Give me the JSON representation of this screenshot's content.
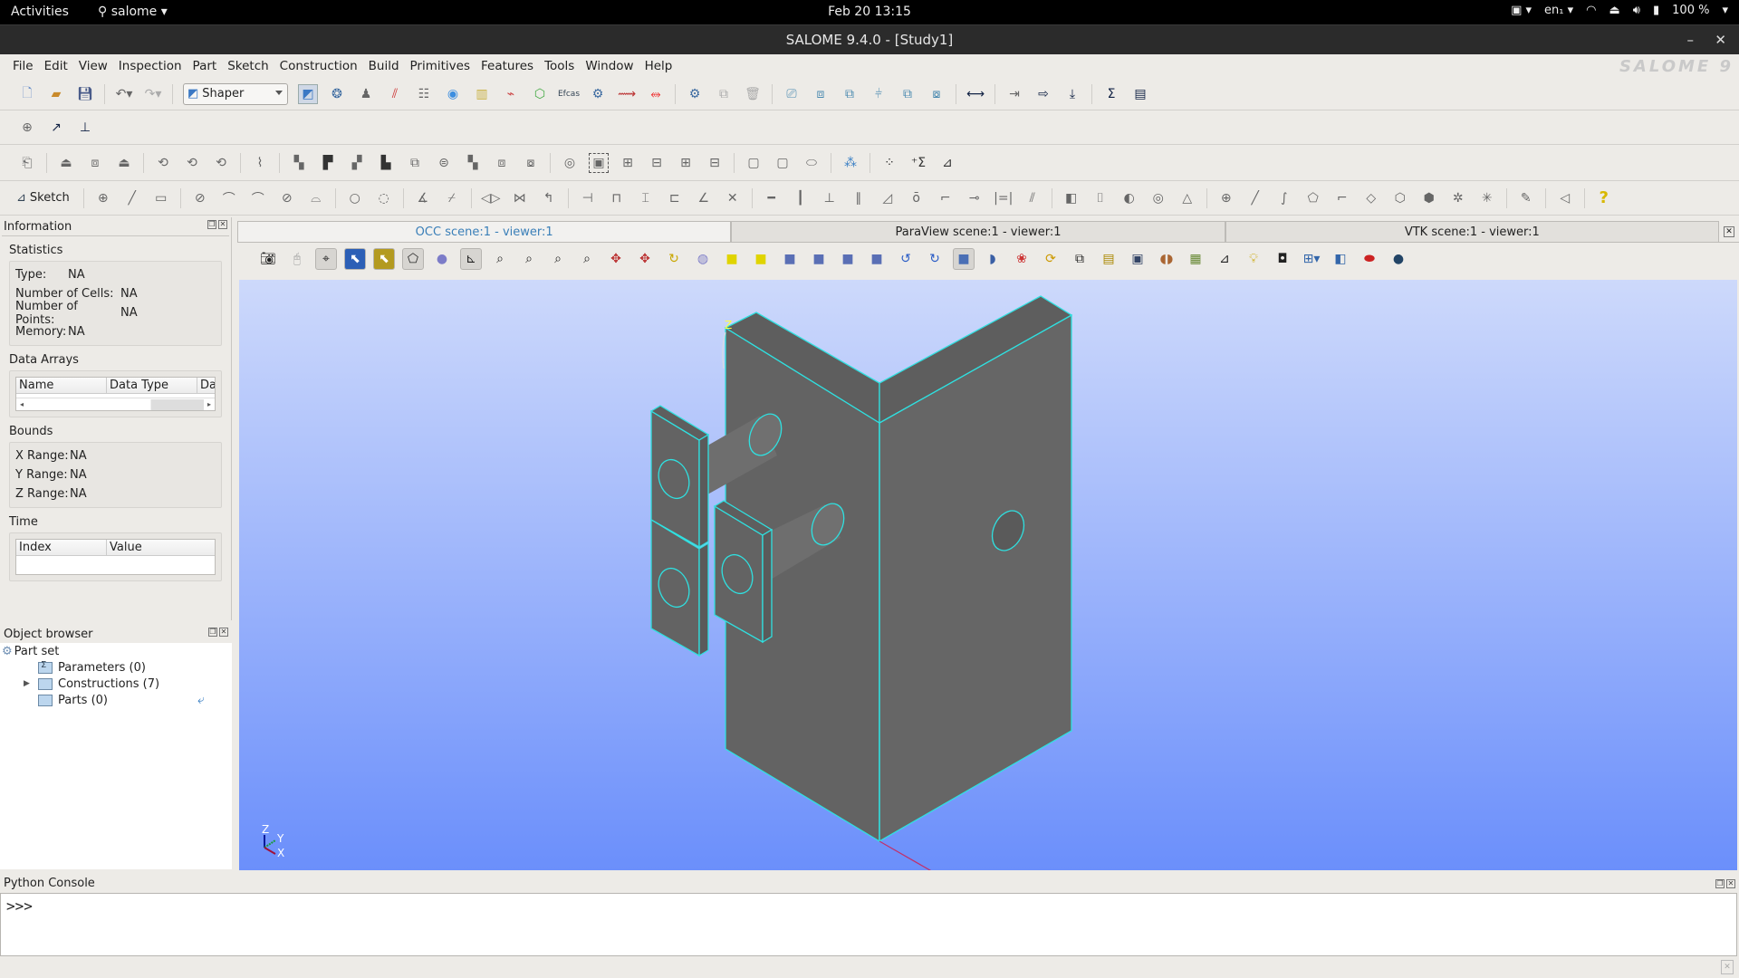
{
  "system_bar": {
    "activities": "Activities",
    "app_name": "salome",
    "clock": "Feb 20  13:15",
    "keyboard_layout": "en₁",
    "battery": "100 %"
  },
  "window": {
    "title": "SALOME 9.4.0 - [Study1]",
    "logo": "SALOME 9"
  },
  "menu": [
    "File",
    "Edit",
    "View",
    "Inspection",
    "Part",
    "Sketch",
    "Construction",
    "Build",
    "Primitives",
    "Features",
    "Tools",
    "Window",
    "Help"
  ],
  "toolbar": {
    "module_combo": "Shaper",
    "sketch_label": "Sketch"
  },
  "info_panel": {
    "title": "Information",
    "statistics_label": "Statistics",
    "statistics": [
      {
        "label": "Type:",
        "value": "NA"
      },
      {
        "label": "Number of Cells:",
        "value": "NA"
      },
      {
        "label": "Number of Points:",
        "value": "NA"
      },
      {
        "label": "Memory:",
        "value": "NA"
      }
    ],
    "data_arrays_label": "Data Arrays",
    "data_arrays_columns": [
      "Name",
      "Data Type",
      "Dat"
    ],
    "bounds_label": "Bounds",
    "bounds": [
      {
        "label": "X Range:",
        "value": "NA"
      },
      {
        "label": "Y Range:",
        "value": "NA"
      },
      {
        "label": "Z Range:",
        "value": "NA"
      }
    ],
    "time_label": "Time",
    "time_columns": [
      "Index",
      "Value"
    ]
  },
  "object_browser": {
    "title": "Object browser",
    "root": "Part set",
    "items": [
      {
        "label": "Parameters (0)",
        "expandable": false
      },
      {
        "label": "Constructions (7)",
        "expandable": true
      },
      {
        "label": "Parts (0)",
        "expandable": false
      }
    ]
  },
  "viewer": {
    "tabs": [
      {
        "label": "OCC scene:1 - viewer:1",
        "active": true
      },
      {
        "label": "ParaView scene:1 - viewer:1",
        "active": false
      },
      {
        "label": "VTK scene:1 - viewer:1",
        "active": false
      }
    ],
    "triedron": {
      "z": "Z",
      "y": "Y",
      "x": "X"
    },
    "origin_label": "Z"
  },
  "python_console": {
    "title": "Python Console",
    "prompt": ">>>"
  },
  "colors": {
    "edge": "#2fe0e0",
    "face": "#626262",
    "bg_top": "#cdd9fb",
    "bg_bottom": "#6b8ffb",
    "active_tab_text": "#3a7fb8"
  }
}
